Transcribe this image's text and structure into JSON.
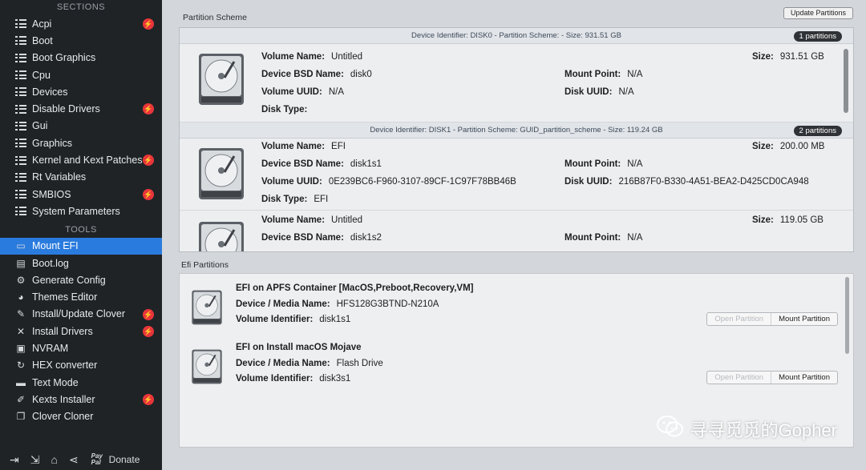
{
  "sidebar": {
    "sections_title": "SECTIONS",
    "tools_title": "TOOLS",
    "sections": [
      {
        "label": "Acpi",
        "badge": true
      },
      {
        "label": "Boot",
        "badge": false
      },
      {
        "label": "Boot Graphics",
        "badge": false
      },
      {
        "label": "Cpu",
        "badge": false
      },
      {
        "label": "Devices",
        "badge": false
      },
      {
        "label": "Disable Drivers",
        "badge": true
      },
      {
        "label": "Gui",
        "badge": false
      },
      {
        "label": "Graphics",
        "badge": false
      },
      {
        "label": "Kernel and Kext Patches",
        "badge": true
      },
      {
        "label": "Rt Variables",
        "badge": false
      },
      {
        "label": "SMBIOS",
        "badge": true
      },
      {
        "label": "System Parameters",
        "badge": false
      }
    ],
    "tools": [
      {
        "label": "Mount EFI",
        "icon": "disk-icon",
        "active": true,
        "badge": false
      },
      {
        "label": "Boot.log",
        "icon": "document-icon",
        "active": false,
        "badge": false
      },
      {
        "label": "Generate Config",
        "icon": "gears-icon",
        "active": false,
        "badge": false
      },
      {
        "label": "Themes Editor",
        "icon": "palette-icon",
        "active": false,
        "badge": false
      },
      {
        "label": "Install/Update Clover",
        "icon": "wrench-icon",
        "active": false,
        "badge": true
      },
      {
        "label": "Install Drivers",
        "icon": "tools-icon",
        "active": false,
        "badge": true
      },
      {
        "label": "NVRAM",
        "icon": "chip-icon",
        "active": false,
        "badge": false
      },
      {
        "label": "HEX converter",
        "icon": "refresh-icon",
        "active": false,
        "badge": false
      },
      {
        "label": "Text Mode",
        "icon": "terminal-icon",
        "active": false,
        "badge": false
      },
      {
        "label": "Kexts Installer",
        "icon": "plug-icon",
        "active": false,
        "badge": true
      },
      {
        "label": "Clover Cloner",
        "icon": "copy-icon",
        "active": false,
        "badge": false
      }
    ],
    "badge_glyph": "⚡",
    "donate_label": "Donate",
    "paypal_label": "Pay Pal"
  },
  "main": {
    "partition_scheme_label": "Partition Scheme",
    "update_button": "Update Partitions",
    "efi_partitions_label": "Efi Partitions",
    "disks": [
      {
        "header": "Device Identifier: DISK0 - Partition Scheme:  - Size: 931.51 GB",
        "count": "1 partitions",
        "volumes": [
          {
            "volume_name": "Untitled",
            "bsd_name": "disk0",
            "volume_uuid": "N/A",
            "disk_type": "",
            "size": "931.51 GB",
            "mount_point": "N/A",
            "disk_uuid": "N/A"
          }
        ]
      },
      {
        "header": "Device Identifier: DISK1 - Partition Scheme: GUID_partition_scheme - Size: 119.24 GB",
        "count": "2 partitions",
        "volumes": [
          {
            "volume_name": "EFI",
            "bsd_name": "disk1s1",
            "volume_uuid": "0E239BC6-F960-3107-89CF-1C97F78BB46B",
            "disk_type": "EFI",
            "size": "200.00 MB",
            "mount_point": "N/A",
            "disk_uuid": "216B87F0-B330-4A51-BEA2-D425CD0CA948"
          },
          {
            "volume_name": "Untitled",
            "bsd_name": "disk1s2",
            "size": "119.05 GB",
            "mount_point": "N/A"
          }
        ]
      }
    ],
    "labels": {
      "volume_name": "Volume Name:",
      "bsd_name": "Device BSD Name:",
      "volume_uuid": "Volume UUID:",
      "disk_type": "Disk Type:",
      "size": "Size:",
      "mount_point": "Mount Point:",
      "disk_uuid": "Disk UUID:",
      "device_media": "Device / Media Name:",
      "volume_identifier": "Volume Identifier:"
    },
    "efi": [
      {
        "title": "EFI on APFS Container [MacOS,Preboot,Recovery,VM]",
        "media": "HFS128G3BTND-N210A",
        "identifier": "disk1s1",
        "open_label": "Open Partition",
        "mount_label": "Mount Partition"
      },
      {
        "title": "EFI on Install macOS Mojave",
        "media": "Flash Drive",
        "identifier": "disk3s1",
        "open_label": "Open Partition",
        "mount_label": "Mount Partition"
      }
    ]
  },
  "watermark": {
    "text": "寻寻觅觅的Gopher"
  }
}
